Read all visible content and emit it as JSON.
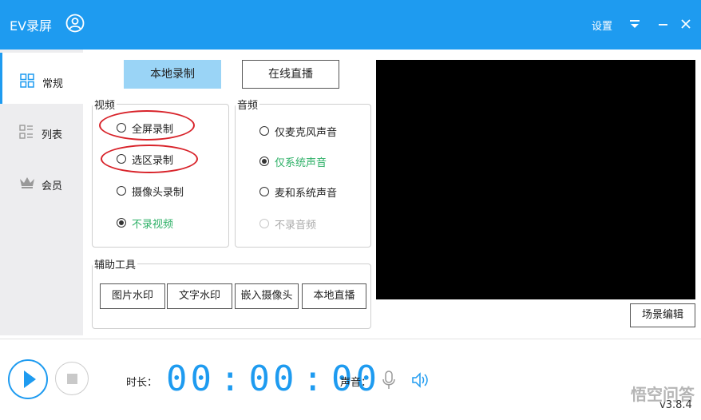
{
  "titlebar": {
    "app_title": "EV录屏",
    "settings_label": "设置",
    "background": "#1e9bf0"
  },
  "sidebar": {
    "items": [
      {
        "label": "常规",
        "icon": "grid-icon",
        "active": true
      },
      {
        "label": "列表",
        "icon": "list-icon",
        "active": false
      },
      {
        "label": "会员",
        "icon": "crown-icon",
        "active": false
      }
    ]
  },
  "main": {
    "tab_local_record": "本地录制",
    "tab_live_stream": "在线直播",
    "video": {
      "title": "视频",
      "options": [
        "全屏录制",
        "选区录制",
        "摄像头录制",
        "不录视频"
      ],
      "selected": "不录视频"
    },
    "audio": {
      "title": "音频",
      "options": [
        "仅麦克风声音",
        "仅系统声音",
        "麦和系统声音",
        "不录音频"
      ],
      "selected": "仅系统声音"
    },
    "tools": {
      "title": "辅助工具",
      "buttons": [
        "图片水印",
        "文字水印",
        "嵌入摄像头",
        "本地直播"
      ]
    },
    "scene_edit": "场景编辑"
  },
  "bottom": {
    "duration_label": "时长：",
    "timer": {
      "hours": "00",
      "minutes": "00",
      "seconds": "00"
    },
    "volume_label": "声音：",
    "version": "v3.8.4",
    "watermark": "悟空问答"
  },
  "colors": {
    "accent": "#1e9bf0",
    "selected_text": "#2eb067",
    "annotation": "#d8232a"
  }
}
